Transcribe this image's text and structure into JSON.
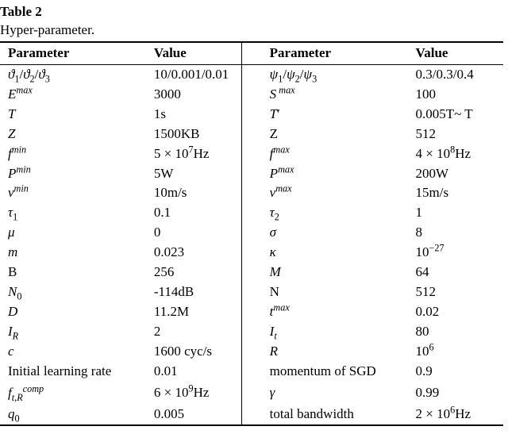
{
  "table_number_label": "Table 2",
  "caption": "Hyper-parameter.",
  "headers": {
    "param": "Parameter",
    "value": "Value"
  },
  "rows": [
    {
      "lp": "<span class='math'>ϑ</span><sub>1</sub>/<span class='math'>ϑ</span><sub>2</sub>/<span class='math'>ϑ</span><sub>3</sub>",
      "lv": "10/0.001/0.01",
      "rp": "<span class='math'>ψ</span><sub>1</sub>/<span class='math'>ψ</span><sub>2</sub>/<span class='math'>ψ</span><sub>3</sub>",
      "rv": "0.3/0.3/0.4"
    },
    {
      "lp": "<span class='math'>E</span><sup><span class='math'>max</span></sup>",
      "lv": "3000",
      "rp": "<span class='math'>S</span><sup>&nbsp;<span class='math'>max</span></sup>",
      "rv": "100"
    },
    {
      "lp": "<span class='math'>T</span>",
      "lv": "1s",
      "rp": "<span class='math'>T</span>&prime;",
      "rv": "0.005T~ T"
    },
    {
      "lp": "<span class='math'>Z</span>",
      "lv": "1500KB",
      "rp": "<span class='scr'>Z</span>",
      "rv": "512"
    },
    {
      "lp": "<span class='math'>f</span><sup><span class='math'>min</span></sup>",
      "lv": "5 × 10<sup>7</sup>Hz",
      "rp": "<span class='math'>f</span><sup><span class='math'>max</span></sup>",
      "rv": "4 × 10<sup>8</sup>Hz"
    },
    {
      "lp": "<span class='math'>P</span><sup><span class='math'>min</span></sup>",
      "lv": "5W",
      "rp": "<span class='math'>P</span><sup><span class='math'>max</span></sup>",
      "rv": "200W"
    },
    {
      "lp": "<span class='math'>v</span><sup><span class='math'>min</span></sup>",
      "lv": "10m/s",
      "rp": "<span class='math'>v</span><sup><span class='math'>max</span></sup>",
      "rv": "15m/s"
    },
    {
      "lp": "<span class='math'>τ</span><sub>1</sub>",
      "lv": "0.1",
      "rp": "<span class='math'>τ</span><sub>2</sub>",
      "rv": "1"
    },
    {
      "lp": "<span class='math'>μ</span>",
      "lv": "0",
      "rp": "<span class='math'>σ</span>",
      "rv": "8"
    },
    {
      "lp": "<span class='math'>m</span>",
      "lv": "0.023",
      "rp": "<span class='math'>κ</span>",
      "rv": "10<sup>−27</sup>"
    },
    {
      "lp": "<span class='scr'>B</span>",
      "lv": "256",
      "rp": "<span class='math'>M</span>",
      "rv": "64"
    },
    {
      "lp": "<span class='math'>N</span><sub>0</sub>",
      "lv": "-114dB",
      "rp": "<span class='scr'>N</span>",
      "rv": "512"
    },
    {
      "lp": "<span class='math'>D</span>",
      "lv": "11.2M",
      "rp": "<span class='math'>t</span><sup><span class='math'>max</span></sup>",
      "rv": "0.02"
    },
    {
      "lp": "<span class='math'>I<sub>R</sub></span>",
      "lv": "2",
      "rp": "<span class='math'>I<sub>t</sub></span>",
      "rv": "80"
    },
    {
      "lp": "<span class='math'>c</span>",
      "lv": "1600 cyc/s",
      "rp": "<span class='math'>R</span>",
      "rv": "10<sup>6</sup>"
    },
    {
      "lp": "Initial learning rate",
      "lv": "0.01",
      "rp": "momentum of SGD",
      "rv": "0.9"
    },
    {
      "lp": "<span class='math'>f</span><span class='sub'><span class='math'>t,R</span></span><span class='sup'><span class='math'>comp</span></span>",
      "lv": "6 × 10<sup>9</sup>Hz",
      "rp": "<span class='math'>γ</span>",
      "rv": "0.99"
    },
    {
      "lp": "<span class='math'>q</span><sub>0</sub>",
      "lv": "0.005",
      "rp": "total bandwidth",
      "rv": "2 × 10<sup>6</sup>Hz"
    }
  ],
  "chart_data": {
    "type": "table",
    "title": "Table 2 — Hyper-parameter.",
    "columns": [
      "Parameter",
      "Value",
      "Parameter",
      "Value"
    ],
    "rows": [
      [
        "ϑ1/ϑ2/ϑ3",
        "10/0.001/0.01",
        "ψ1/ψ2/ψ3",
        "0.3/0.3/0.4"
      ],
      [
        "E^max",
        "3000",
        "S^max",
        "100"
      ],
      [
        "T",
        "1s",
        "T'",
        "0.005T~ T"
      ],
      [
        "Z",
        "1500KB",
        "𝒵",
        "512"
      ],
      [
        "f^min",
        "5×10^7 Hz",
        "f^max",
        "4×10^8 Hz"
      ],
      [
        "P^min",
        "5W",
        "P^max",
        "200W"
      ],
      [
        "v^min",
        "10m/s",
        "v^max",
        "15m/s"
      ],
      [
        "τ1",
        "0.1",
        "τ2",
        "1"
      ],
      [
        "μ",
        "0",
        "σ",
        "8"
      ],
      [
        "m",
        "0.023",
        "κ",
        "10^-27"
      ],
      [
        "ℬ",
        "256",
        "M",
        "64"
      ],
      [
        "N0",
        "-114dB",
        "𝒩",
        "512"
      ],
      [
        "D",
        "11.2M",
        "t^max",
        "0.02"
      ],
      [
        "I_R",
        "2",
        "I_t",
        "80"
      ],
      [
        "c",
        "1600 cyc/s",
        "R",
        "10^6"
      ],
      [
        "Initial learning rate",
        "0.01",
        "momentum of SGD",
        "0.9"
      ],
      [
        "f_{t,R}^{comp}",
        "6×10^9 Hz",
        "γ",
        "0.99"
      ],
      [
        "q0",
        "0.005",
        "total bandwidth",
        "2×10^6 Hz"
      ]
    ]
  }
}
